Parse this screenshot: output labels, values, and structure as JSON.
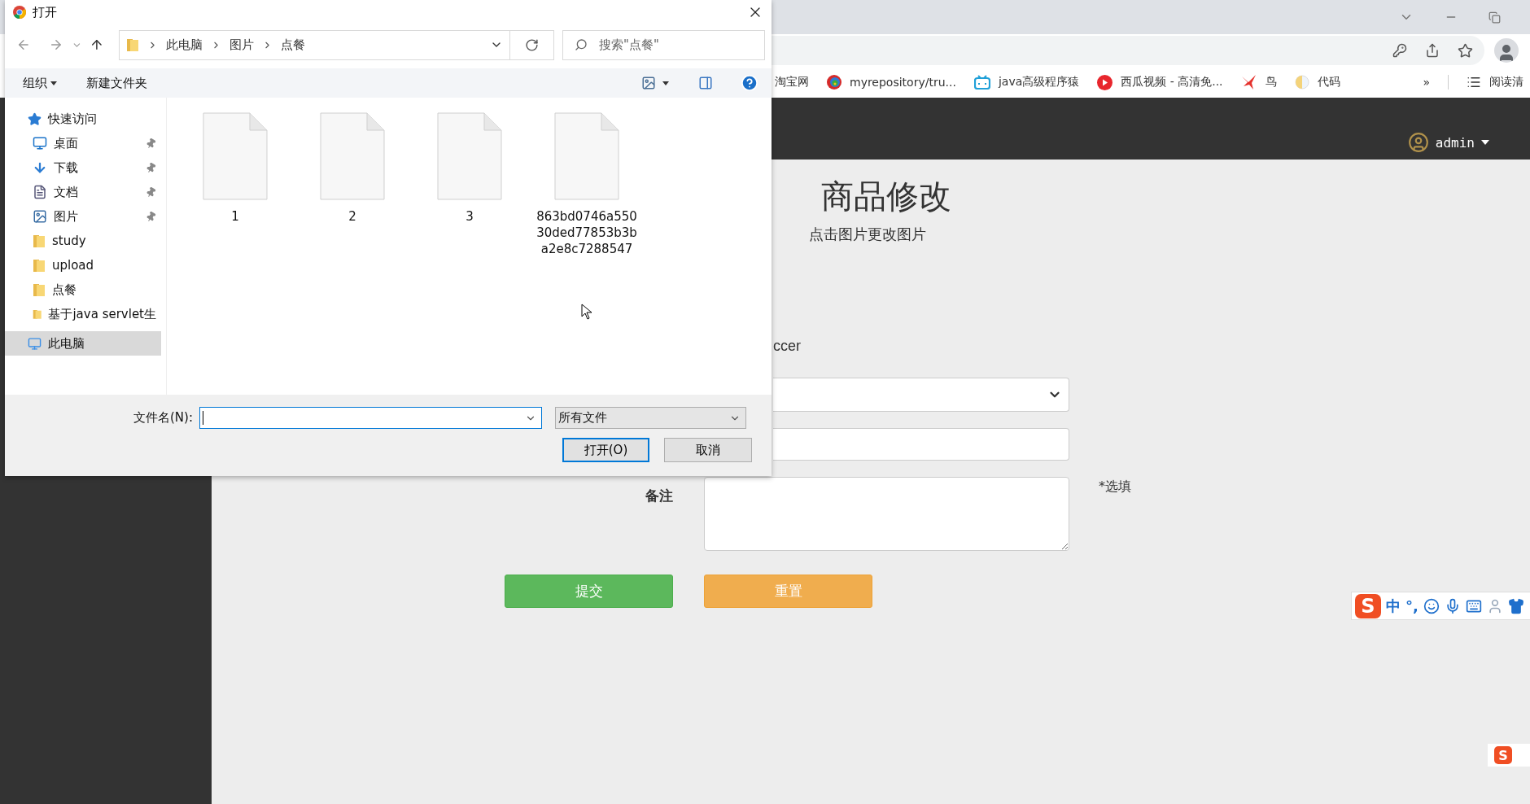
{
  "browser": {
    "bookmarks": [
      {
        "label": "淘宝网",
        "kind": "none"
      },
      {
        "label": "myrepository/tru...",
        "kind": "swirl"
      },
      {
        "label": "java高级程序猿",
        "kind": "tv"
      },
      {
        "label": "西瓜视频 - 高清免...",
        "kind": "play"
      },
      {
        "label": "鸟",
        "kind": "bird"
      },
      {
        "label": "代码",
        "kind": "moon"
      }
    ],
    "overflow": "»",
    "reading_list": "阅读清"
  },
  "page": {
    "user": "admin",
    "title": "商品修改",
    "subtitle": "点击图片更改图片",
    "partial_label": "ccer",
    "remark_label": "备注",
    "remark_hint": "*选填",
    "buttons": [
      {
        "label": "提交",
        "kind": "submit"
      },
      {
        "label": "重置",
        "kind": "reset"
      }
    ]
  },
  "dialog": {
    "title": "打开",
    "breadcrumb": [
      "此电脑",
      "图片",
      "点餐"
    ],
    "search": {
      "placeholder": "搜索\"点餐\""
    },
    "organize": "组织",
    "new_folder": "新建文件夹",
    "nav": [
      {
        "label": "快速访问",
        "kind": "quick",
        "pinned": false,
        "selected": false
      },
      {
        "label": "桌面",
        "kind": "desktop",
        "pinned": true,
        "selected": false
      },
      {
        "label": "下载",
        "kind": "download",
        "pinned": true,
        "selected": false
      },
      {
        "label": "文档",
        "kind": "document",
        "pinned": true,
        "selected": false
      },
      {
        "label": "图片",
        "kind": "pictures",
        "pinned": true,
        "selected": false
      },
      {
        "label": "study",
        "kind": "folder",
        "pinned": false,
        "selected": false
      },
      {
        "label": "upload",
        "kind": "folder",
        "pinned": false,
        "selected": false
      },
      {
        "label": "点餐",
        "kind": "folder",
        "pinned": false,
        "selected": false
      },
      {
        "label": "基于java servlet生",
        "kind": "folder",
        "pinned": false,
        "selected": false
      },
      {
        "label": "此电脑",
        "kind": "pc",
        "pinned": false,
        "selected": true
      }
    ],
    "files": [
      {
        "name": "1"
      },
      {
        "name": "2"
      },
      {
        "name": "3"
      },
      {
        "name": "863bd0746a55030ded77853b3ba2e8c7288547"
      }
    ],
    "filename_label": "文件名(N):",
    "filename": {
      "focused": true
    },
    "file_type": "所有文件",
    "buttons": [
      {
        "label": "打开(O)",
        "default": true
      },
      {
        "label": "取消",
        "default": false
      }
    ]
  },
  "ime": {
    "logo": "S",
    "mode": "中",
    "punct": "°,",
    "mini_logo": "S"
  }
}
